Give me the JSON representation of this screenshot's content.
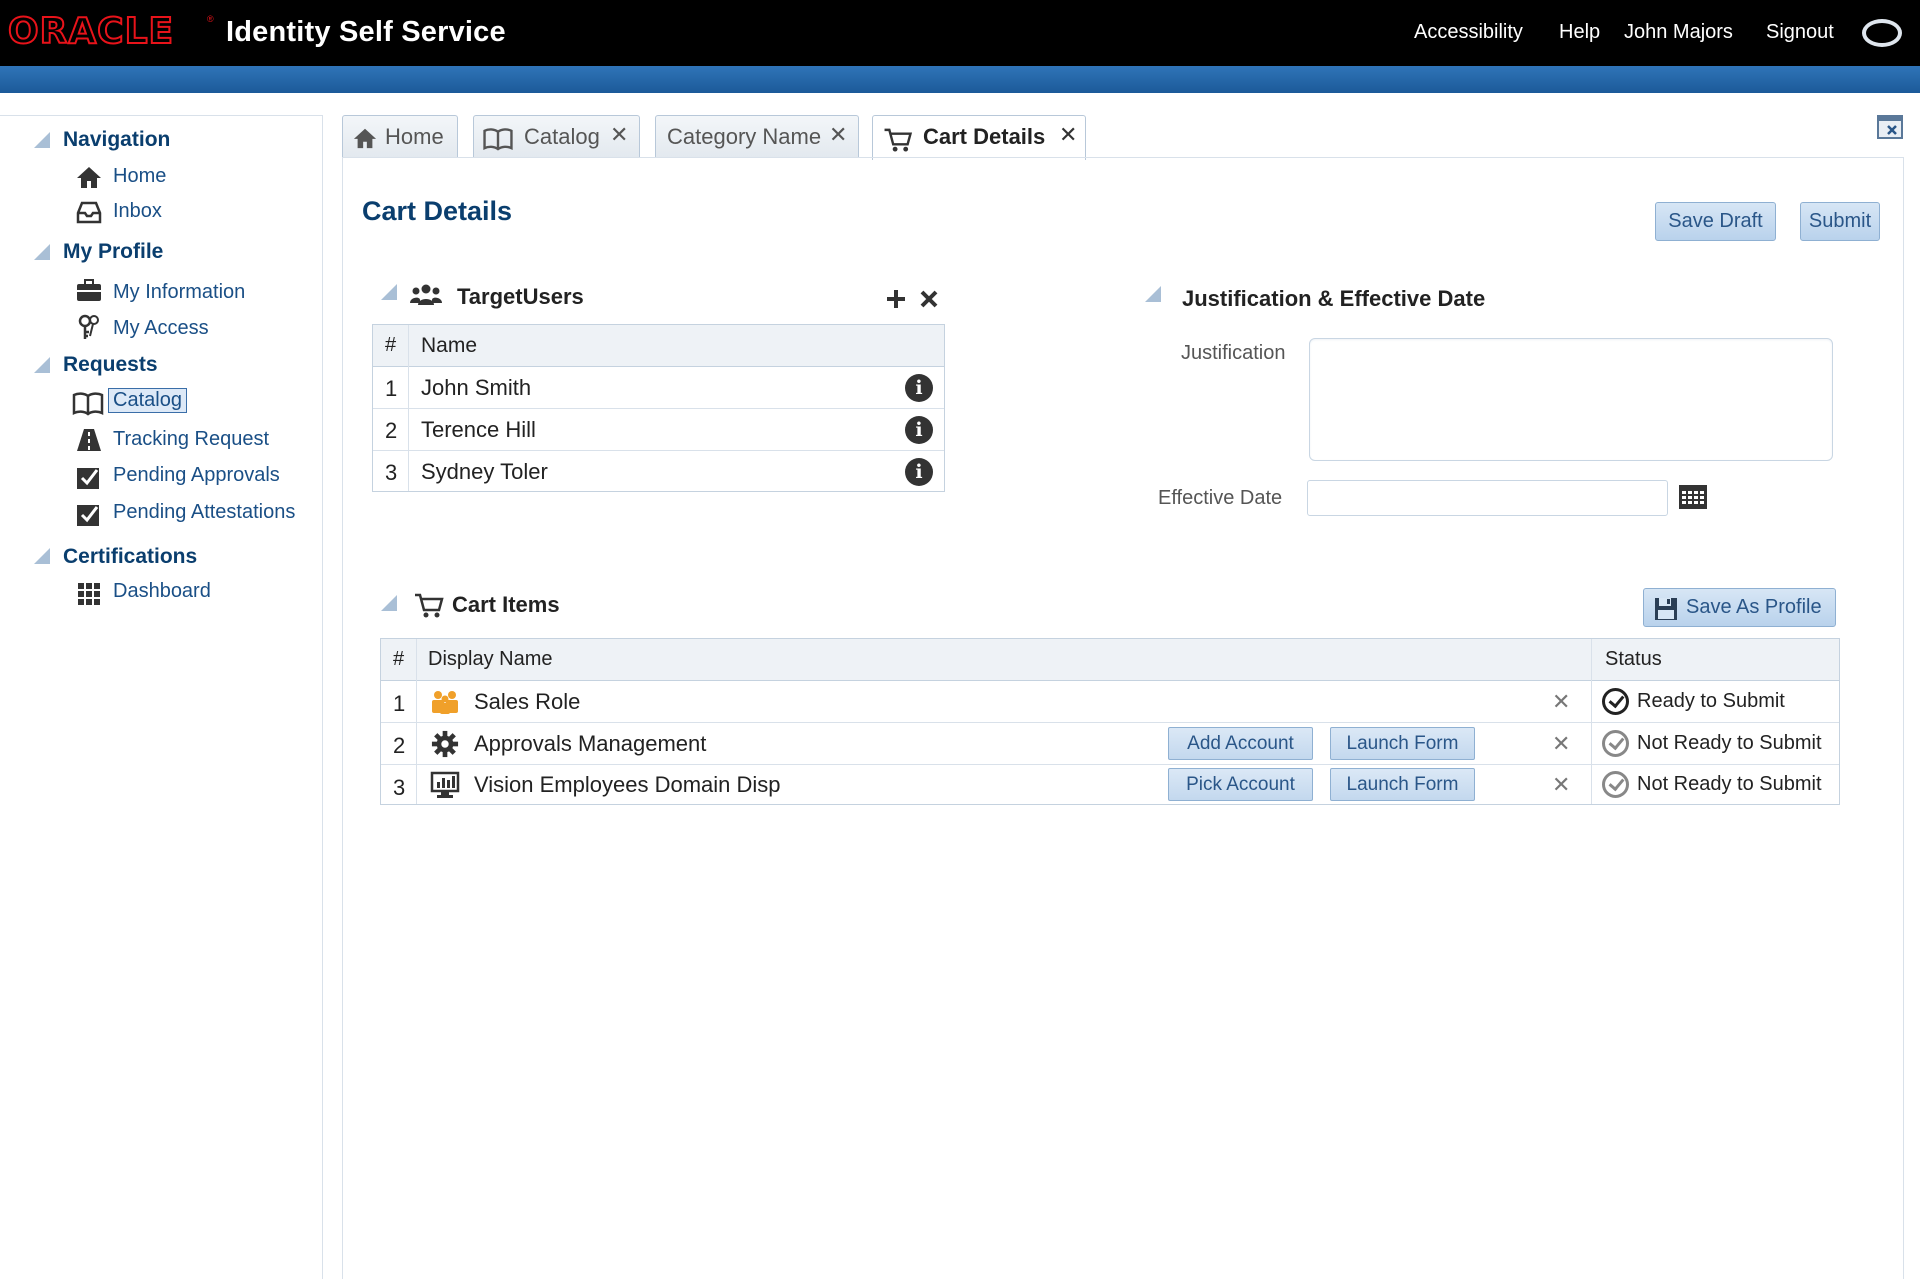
{
  "header": {
    "brand": "ORACLE",
    "app_title": "Identity Self Service",
    "links": [
      "Accessibility",
      "Help",
      "John Majors",
      "Signout"
    ]
  },
  "sidebar": {
    "sections": [
      {
        "title": "Navigation",
        "items": [
          "Home",
          "Inbox"
        ]
      },
      {
        "title": "My Profile",
        "items": [
          "My Information",
          "My Access"
        ]
      },
      {
        "title": "Requests",
        "items": [
          "Catalog",
          "Tracking Request",
          "Pending Approvals",
          "Pending Attestations"
        ]
      },
      {
        "title": "Certifications",
        "items": [
          "Dashboard"
        ]
      }
    ],
    "selected": "Catalog"
  },
  "tabs": [
    {
      "label": "Home"
    },
    {
      "label": "Catalog",
      "close": "✕"
    },
    {
      "label": "Category Name",
      "close": "✕"
    },
    {
      "label": "Cart Details",
      "close": "✕",
      "active": true
    }
  ],
  "page": {
    "title": "Cart Details",
    "save_draft": "Save Draft",
    "submit": "Submit"
  },
  "target_users": {
    "title": "TargetUsers",
    "columns": [
      "#",
      "Name"
    ],
    "rows": [
      {
        "num": "1",
        "name": "John Smith"
      },
      {
        "num": "2",
        "name": "Terence Hill"
      },
      {
        "num": "3",
        "name": "Sydney Toler"
      }
    ]
  },
  "justification": {
    "title": "Justification & Effective Date",
    "justification_label": "Justification",
    "effective_date_label": "Effective Date"
  },
  "cart_items": {
    "title": "Cart Items",
    "save_profile": "Save As Profile",
    "columns": [
      "#",
      "Display Name",
      "Status"
    ],
    "rows": [
      {
        "num": "1",
        "name": "Sales Role",
        "status": "Ready to Submit"
      },
      {
        "num": "2",
        "name": "Approvals Management",
        "btn1": "Add Account",
        "btn2": "Launch Form",
        "status": "Not Ready to Submit"
      },
      {
        "num": "3",
        "name": "Vision Employees Domain Disp",
        "btn1": "Pick Account",
        "btn2": "Launch Form",
        "status": "Not Ready to Submit"
      }
    ]
  },
  "colors": {
    "header_bg": "#000000",
    "brand_red": "#e8131a",
    "blue_bar": "#2f74b8",
    "title_blue": "#0a3e6e",
    "link_blue": "#1a4f86"
  }
}
